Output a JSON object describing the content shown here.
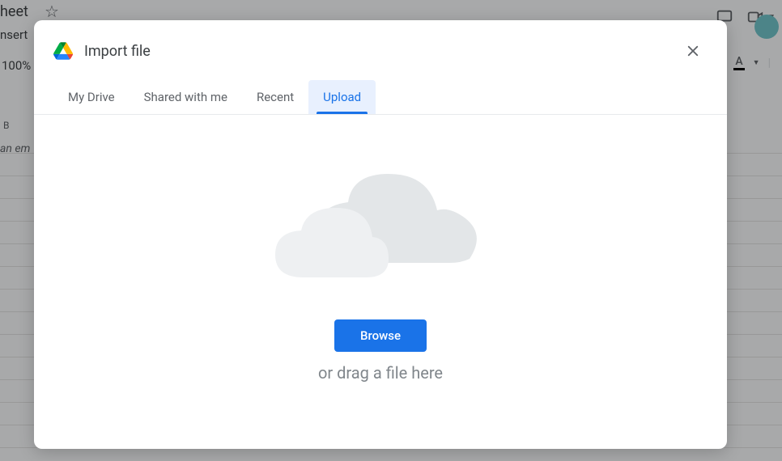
{
  "background": {
    "title_fragment": "heet",
    "menu_fragment": "nsert",
    "zoom": "100%",
    "col_header": "B",
    "cell_text_fragment": "an em"
  },
  "modal": {
    "title": "Import file",
    "tabs": {
      "my_drive": "My Drive",
      "shared": "Shared with me",
      "recent": "Recent",
      "upload": "Upload"
    },
    "browse_label": "Browse",
    "drag_text": "or drag a file here"
  }
}
